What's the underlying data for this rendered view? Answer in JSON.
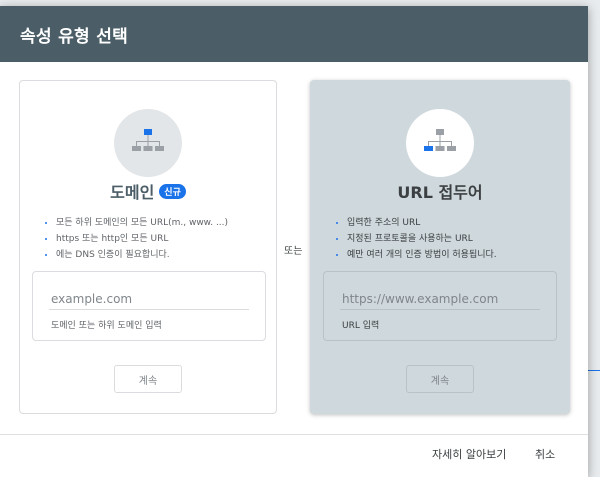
{
  "dialog": {
    "title": "속성 유형 선택",
    "or_label": "또는",
    "footer": {
      "learn_more": "자세히 알아보기",
      "cancel": "취소"
    }
  },
  "domain_card": {
    "title": "도메인",
    "badge": "신규",
    "bullets": [
      "모든 하위 도메인의 모든 URL(m., www. ...)",
      "https 또는 http인 모든 URL",
      "에는 DNS 인증이 필요합니다."
    ],
    "input_placeholder": "example.com",
    "input_helper": "도메인 또는 하위 도메인 입력",
    "continue_label": "계속"
  },
  "url_card": {
    "title": "URL 접두어",
    "bullets": [
      "입력한 주소의 URL",
      "지정된 프로토콜을 사용하는 URL",
      "예만 여러 개의 인증 방법이 허용됩니다."
    ],
    "input_placeholder": "https://www.example.com",
    "input_helper": "URL 입력",
    "continue_label": "계속"
  },
  "colors": {
    "header": "#4b5d67",
    "accent": "#1a73e8",
    "selected_card": "#cfd8dc"
  }
}
